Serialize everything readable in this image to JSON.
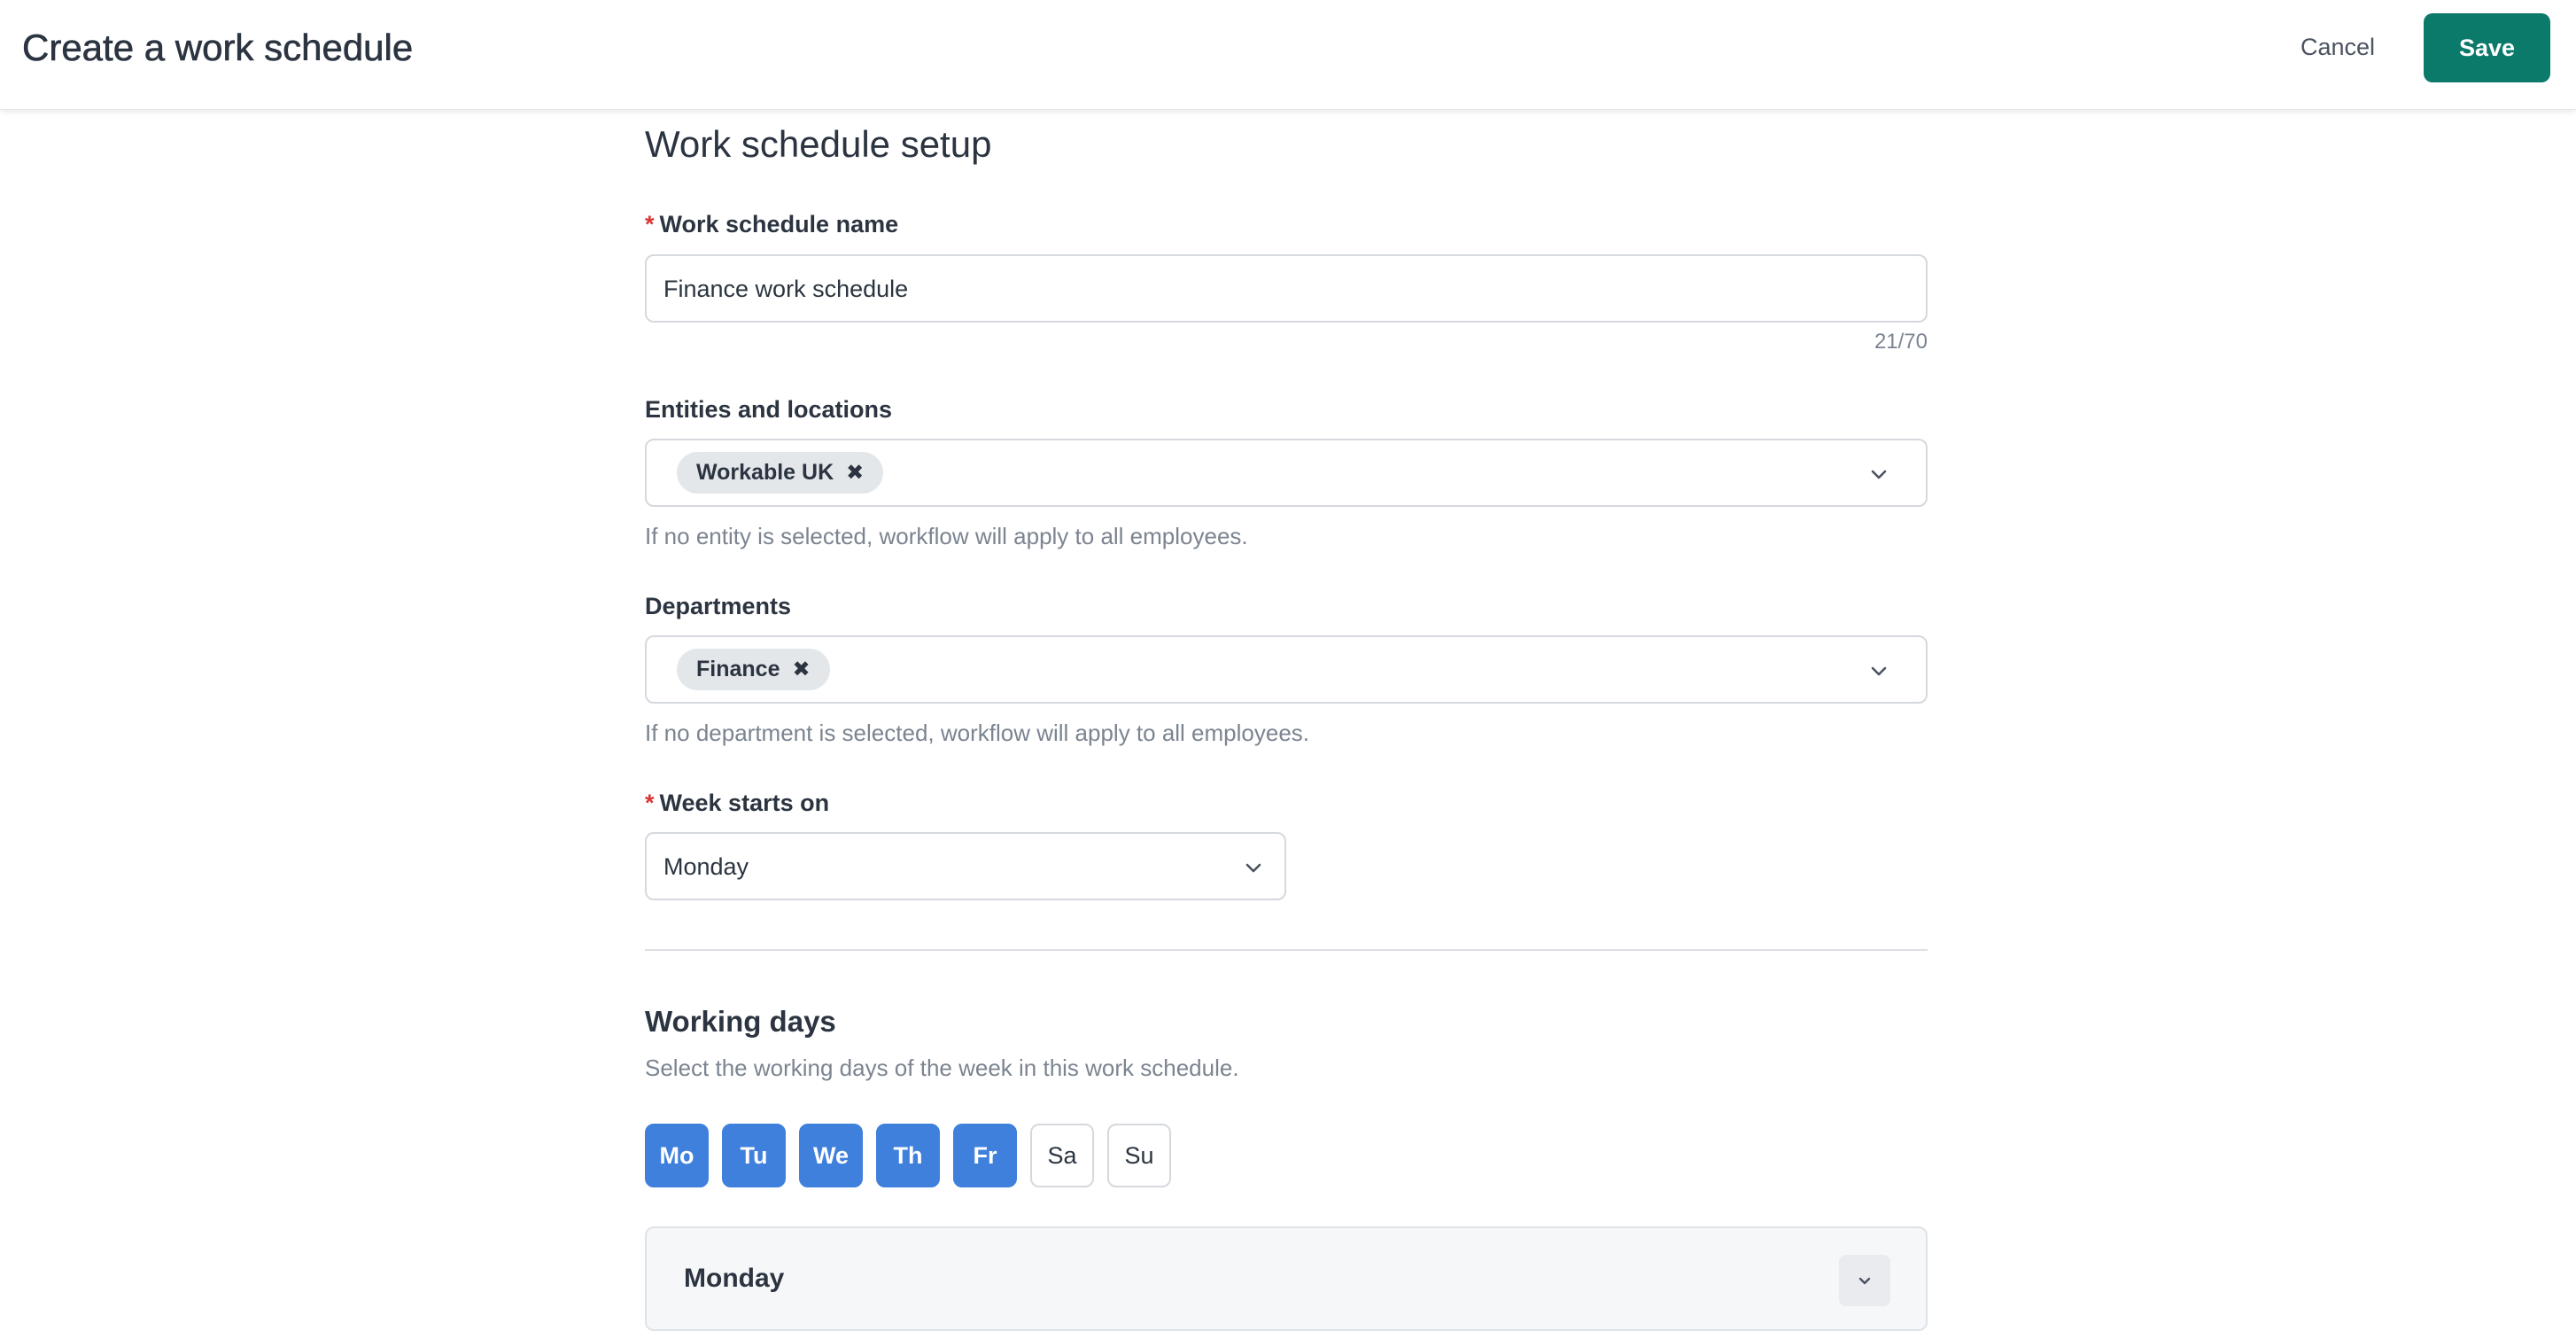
{
  "header": {
    "title": "Create a work schedule",
    "cancel_label": "Cancel",
    "save_label": "Save"
  },
  "form": {
    "section_title": "Work schedule setup",
    "schedule_name": {
      "label": "Work schedule name",
      "required_marker": "*",
      "value": "Finance work schedule",
      "counter": "21/70"
    },
    "entities": {
      "label": "Entities and locations",
      "chips": [
        "Workable UK"
      ],
      "chip_remove_glyph": "✖",
      "hint": "If no entity is selected, workflow will apply to all employees."
    },
    "departments": {
      "label": "Departments",
      "chips": [
        "Finance"
      ],
      "chip_remove_glyph": "✖",
      "hint": "If no department is selected, workflow will apply to all employees."
    },
    "week_start": {
      "label": "Week starts on",
      "required_marker": "*",
      "value": "Monday"
    }
  },
  "working_days": {
    "title": "Working days",
    "subtitle": "Select the working days of the week in this work schedule.",
    "days": [
      {
        "label": "Mo",
        "selected": true
      },
      {
        "label": "Tu",
        "selected": true
      },
      {
        "label": "We",
        "selected": true
      },
      {
        "label": "Th",
        "selected": true
      },
      {
        "label": "Fr",
        "selected": true
      },
      {
        "label": "Sa",
        "selected": false
      },
      {
        "label": "Su",
        "selected": false
      }
    ],
    "accordion": {
      "title": "Monday",
      "toggle_icon": "chevron-down-icon"
    }
  },
  "colors": {
    "primary": "#0b7a6b",
    "day_selected": "#3f80dc",
    "required": "#d93636"
  }
}
